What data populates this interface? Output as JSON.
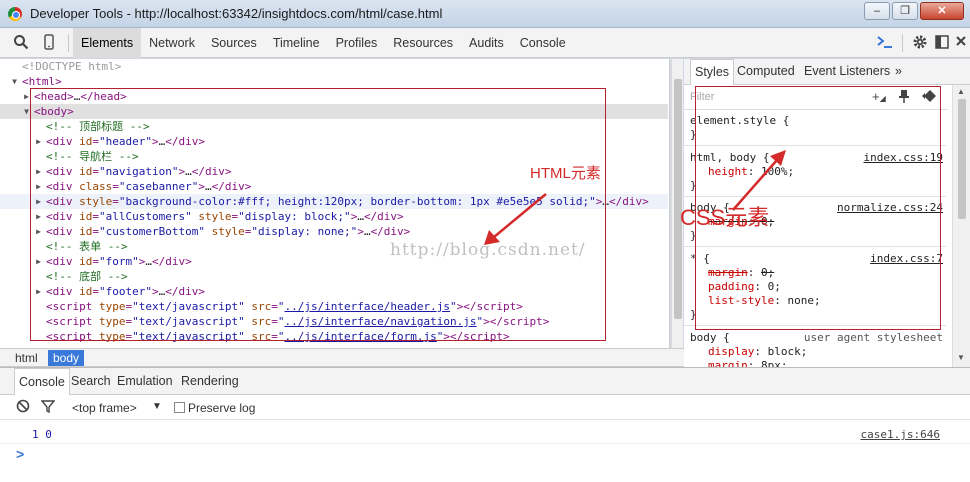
{
  "window": {
    "title": "Developer Tools - http://localhost:63342/insightdocs.com/html/case.html",
    "controls": [
      "–",
      "❐",
      "✕"
    ]
  },
  "toolbar": {
    "tabs": [
      "Elements",
      "Network",
      "Sources",
      "Timeline",
      "Profiles",
      "Resources",
      "Audits",
      "Console"
    ],
    "active_tab": "Elements",
    "icons": [
      "search-icon",
      "device-icon",
      "console-drawer-icon",
      "settings-icon",
      "dock-icon",
      "close-icon"
    ]
  },
  "elements_tree": {
    "doctype": "<!DOCTYPE html>",
    "html_open": "html",
    "head_tag": "head",
    "body_tag": "body",
    "comment_header": "<!-- 顶部标题 -->",
    "header_id": "\"header\"",
    "comment_nav": "<!-- 导航栏 -->",
    "nav_id": "\"navigation\"",
    "banner_class": "\"casebanner\"",
    "styled_div_style": "\"background-color:#fff; height:120px; border-bottom: 1px #e5e5e5 solid;\"",
    "customers_id": "\"allCustomers\"",
    "customers_style": "\"display: block;\"",
    "bottom_id": "\"customerBottom\"",
    "bottom_style": "\"display: none;\"",
    "comment_form": "<!-- 表单 -->",
    "form_id": "\"form\"",
    "comment_footer": "<!-- 底部 -->",
    "footer_id": "\"footer\"",
    "script_type": "\"text/javascript\"",
    "script_src_1": "../js/interface/header.js",
    "script_src_2": "../js/interface/navigation.js",
    "script_src_3": "../js/interface/form.js",
    "ellipsis": "…"
  },
  "breadcrumb": {
    "items": [
      "html",
      "body"
    ],
    "active": "body"
  },
  "styles_pane": {
    "tabs": [
      "Styles",
      "Computed",
      "Event Listeners"
    ],
    "more": "»",
    "filter_placeholder": "Filter",
    "element_style": "element.style {",
    "close_brace": "}",
    "rule1_selector": "html, body {",
    "rule1_source": "index.css:19",
    "rule1_prop": "height",
    "rule1_val": "100%;",
    "rule2_selector": "body {",
    "rule2_source": "normalize.css:24",
    "rule2_prop": "margin",
    "rule2_val": "0;",
    "rule3_selector": "* {",
    "rule3_source": "index.css:7",
    "rule3_prop1": "margin",
    "rule3_val1": "0;",
    "rule3_prop2": "padding",
    "rule3_val2": "0;",
    "rule3_prop3": "list-style",
    "rule3_val3": "none;",
    "rule4_selector": "body {",
    "rule4_source": "user agent stylesheet",
    "rule4_prop1": "display",
    "rule4_val1": "block;",
    "rule4_prop2": "margin",
    "rule4_val2": "8px;"
  },
  "drawer": {
    "tabs": [
      "Console",
      "Search",
      "Emulation",
      "Rendering"
    ],
    "active_tab": "Console",
    "context": "<top frame>",
    "preserve_log": "Preserve log",
    "output_message": "1 0",
    "output_source": "case1.js:646",
    "prompt": ">"
  },
  "annotations": {
    "html_label": "HTML元素",
    "css_label": "CSS元素",
    "watermark": "http://blog.csdn.net/",
    "color": "#d42a2a"
  }
}
